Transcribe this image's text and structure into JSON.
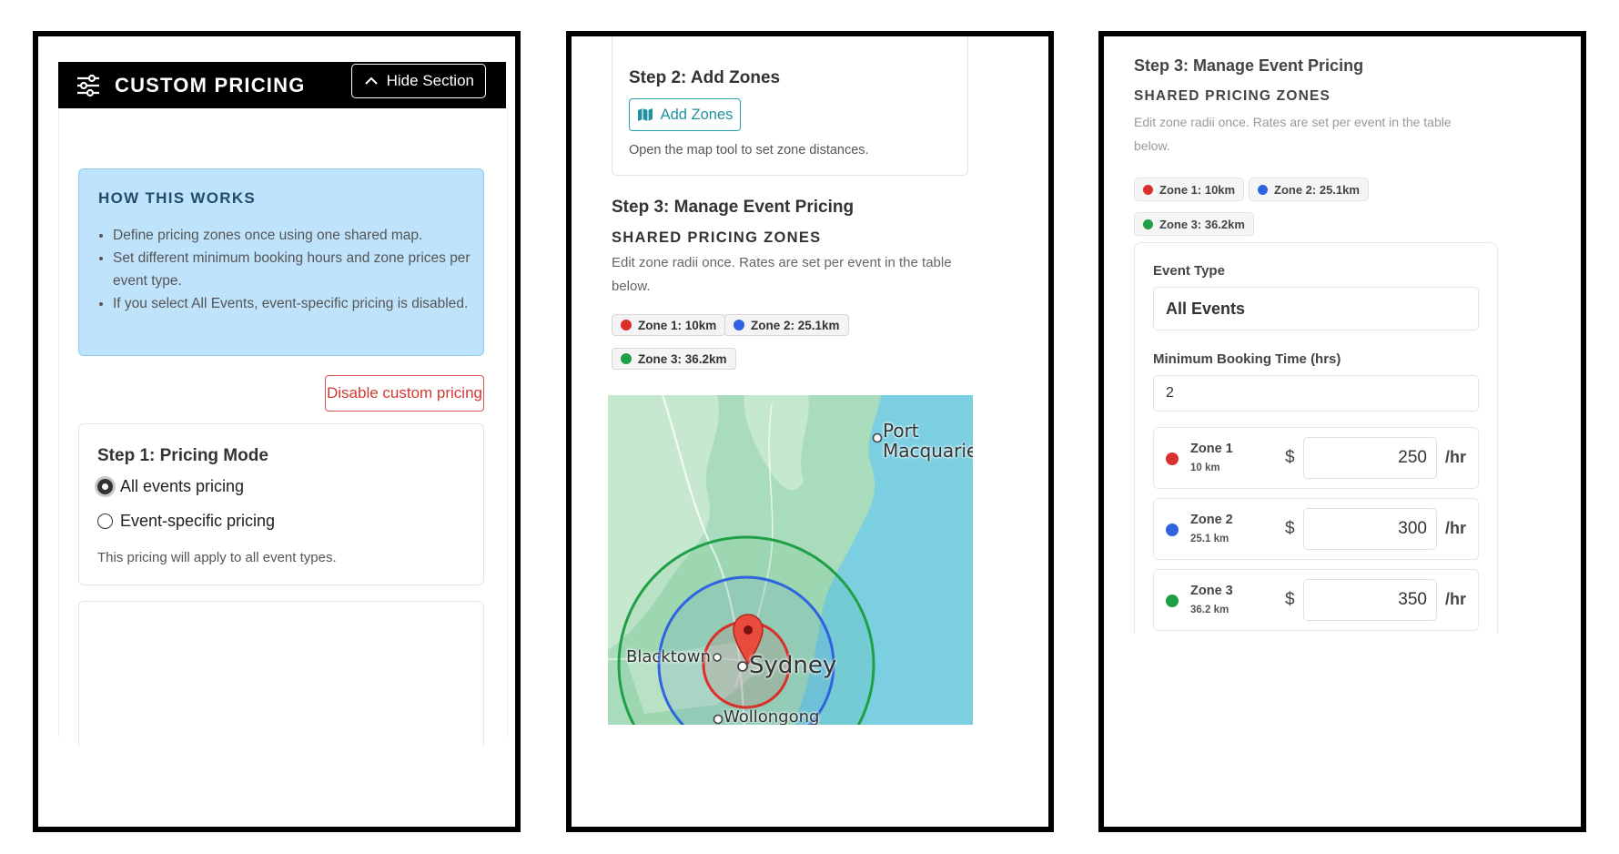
{
  "panel1": {
    "header_title": "CUSTOM PRICING",
    "hide_label": "Hide Section",
    "info_title": "HOW THIS WORKS",
    "info_items": [
      "Define pricing zones once using one shared map.",
      "Set different minimum booking hours and zone prices per event type.",
      "If you select All Events, event-specific pricing is disabled."
    ],
    "disable_label": "Disable custom pricing",
    "step1_title": "Step 1: Pricing Mode",
    "radio_all": "All events pricing",
    "radio_specific": "Event-specific pricing",
    "selected_mode": "All events pricing",
    "mode_note": "This pricing will apply to all event types."
  },
  "panel2": {
    "step2_title": "Step 2: Add Zones",
    "add_zones_label": "Add Zones",
    "add_zones_note": "Open the map tool to set zone distances.",
    "step3_title": "Step 3: Manage Event Pricing",
    "shared_title": "SHARED PRICING ZONES",
    "shared_desc": "Edit zone radii once. Rates are set per event in the table below.",
    "chips": [
      "Zone 1: 10km",
      "Zone 2: 25.1km",
      "Zone 3: 36.2km"
    ],
    "map_labels": {
      "port": "Port",
      "macquarie": "Macquarie",
      "blacktown": "Blacktown",
      "sydney": "Sydney",
      "wollongong": "Wollongong"
    }
  },
  "panel3": {
    "step3_title": "Step 3: Manage Event Pricing",
    "shared_title": "SHARED PRICING ZONES",
    "shared_desc": "Edit zone radii once. Rates are set per event in the table below.",
    "chips": [
      "Zone 1: 10km",
      "Zone 2: 25.1km",
      "Zone 3: 36.2km"
    ],
    "event_type_label": "Event Type",
    "event_type_value": "All Events",
    "min_booking_label": "Minimum Booking Time (hrs)",
    "min_booking_value": "2",
    "zones": [
      {
        "name": "Zone 1",
        "dist": "10 km",
        "currency": "$",
        "rate": "250",
        "unit": "/hr"
      },
      {
        "name": "Zone 2",
        "dist": "25.1 km",
        "currency": "$",
        "rate": "300",
        "unit": "/hr"
      },
      {
        "name": "Zone 3",
        "dist": "36.2 km",
        "currency": "$",
        "rate": "350",
        "unit": "/hr"
      }
    ]
  },
  "colors": {
    "zone1": "#d9302c",
    "zone2": "#2f63e0",
    "zone3": "#1fa046",
    "accent_teal": "#2193a0",
    "danger": "#d13a36",
    "info_bg": "#bfe3fb"
  }
}
